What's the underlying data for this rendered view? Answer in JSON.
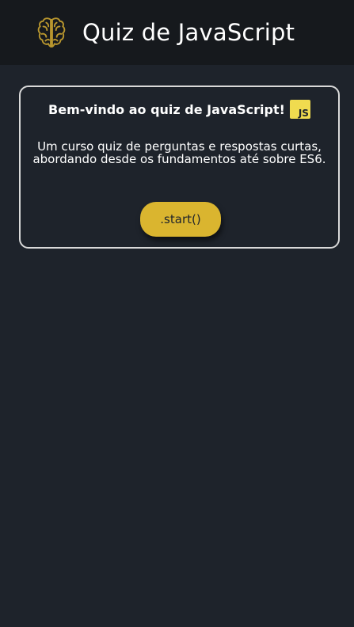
{
  "header": {
    "icon": "brain-icon",
    "title": "Quiz de JavaScript"
  },
  "card": {
    "welcome": "Bem-vindo ao quiz de JavaScript!",
    "badge_icon": "javascript-logo-icon",
    "badge_text": "JS",
    "description": "Um curso quiz de perguntas e respostas curtas, abordando desde os fundamentos até sobre ES6.",
    "start_label": ".start()"
  },
  "colors": {
    "background": "#1e232b",
    "header": "#16191d",
    "accent": "#dab52f",
    "js_yellow": "#f0db4f",
    "card_border": "#d9d9d9"
  }
}
